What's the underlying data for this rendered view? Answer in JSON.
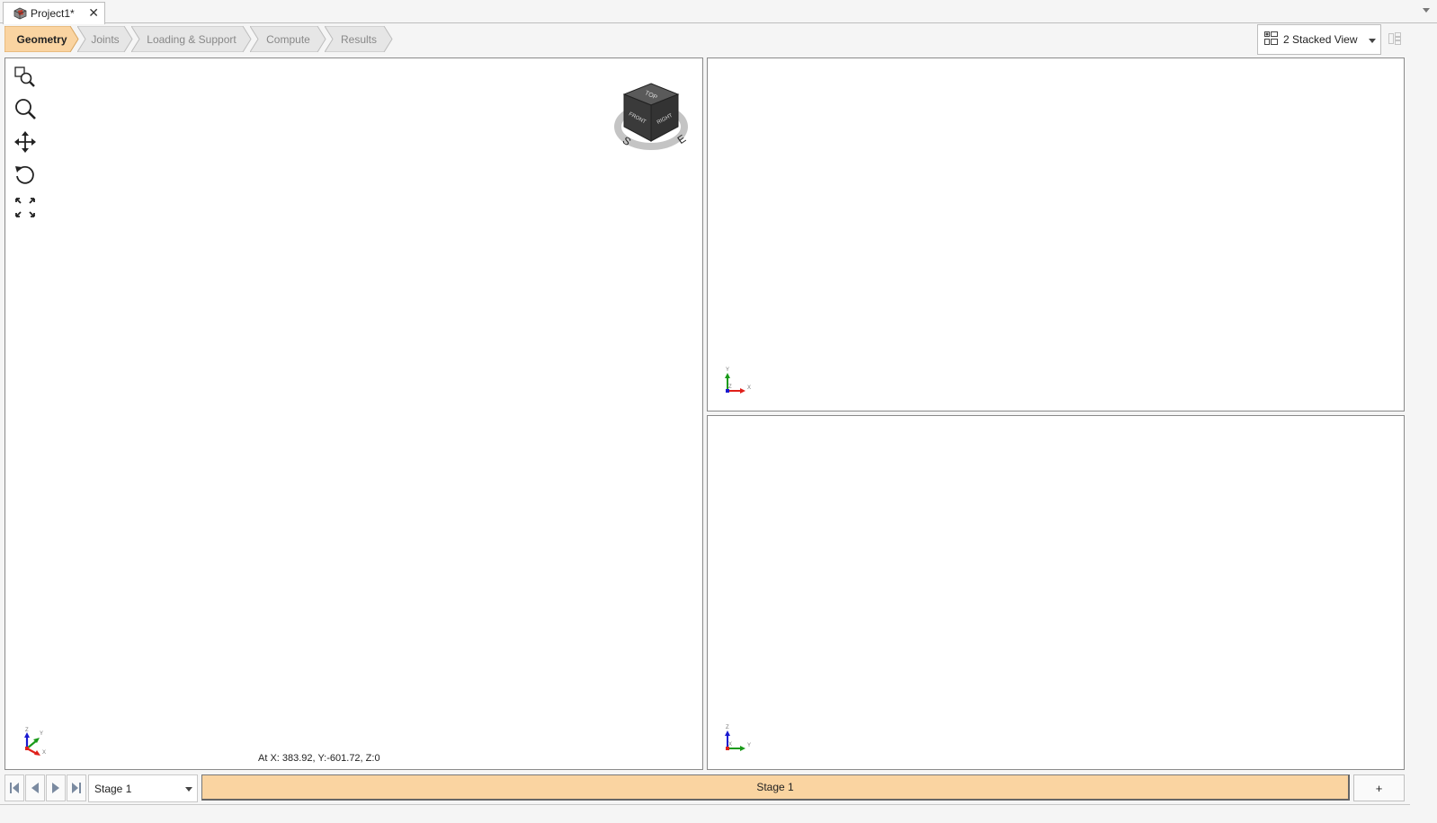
{
  "document_tab": {
    "title": "Project1*",
    "icon": "project-icon",
    "close_icon": "close-icon"
  },
  "workflow": {
    "steps": [
      {
        "label": "Geometry",
        "active": true
      },
      {
        "label": "Joints",
        "active": false
      },
      {
        "label": "Loading & Support",
        "active": false
      },
      {
        "label": "Compute",
        "active": false
      },
      {
        "label": "Results",
        "active": false
      }
    ],
    "active_color": "#fad4a1",
    "inactive_color": "#e6e6e6"
  },
  "view_selector": {
    "selected": "2 Stacked View",
    "icon": "stacked-view-icon"
  },
  "main_viewport": {
    "tools": [
      {
        "name": "zoom-window-icon"
      },
      {
        "name": "zoom-icon"
      },
      {
        "name": "pan-icon"
      },
      {
        "name": "rotate-icon"
      },
      {
        "name": "zoom-extents-icon"
      }
    ],
    "navcube": {
      "top": "TOP",
      "front": "FRONT",
      "right": "RIGHT",
      "compass_s": "S",
      "compass_e": "E"
    },
    "axis_labels": {
      "x": "X",
      "y": "Y",
      "z": "Z"
    },
    "coordinates": "At X: 383.92, Y:-601.72, Z:0"
  },
  "top_viewport": {
    "axis_labels": {
      "x": "X",
      "y": "Y",
      "z": "Z"
    }
  },
  "bottom_viewport": {
    "axis_labels": {
      "x": "X",
      "y": "Y",
      "z": "Z"
    }
  },
  "bottom_bar": {
    "stage_dropdown": "Stage 1",
    "stage_tab": "Stage 1",
    "add_label": "+"
  },
  "colors": {
    "accent": "#fad4a1",
    "axis_x": "#e0201a",
    "axis_y": "#1a9a1a",
    "axis_z": "#1a1ad0"
  }
}
